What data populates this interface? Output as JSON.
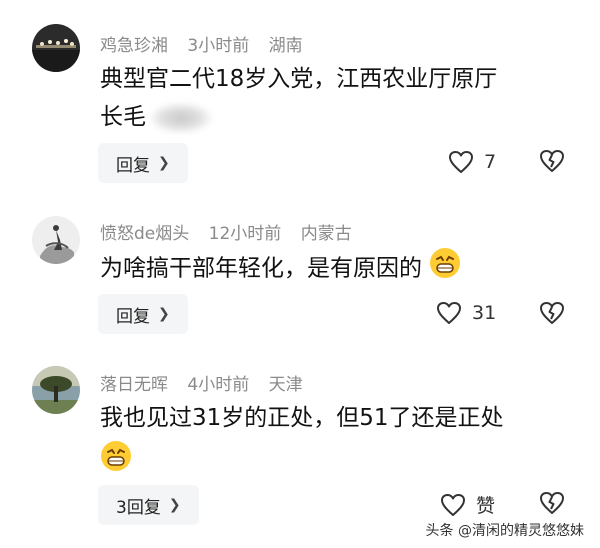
{
  "comments": [
    {
      "username": "鸡急珍湘",
      "time": "3小时前",
      "location": "湖南",
      "text_line1": "典型官二代18岁入党，江西农业厅原厅",
      "text_line2": "长毛",
      "reply_label": "回复",
      "like_count": "7"
    },
    {
      "username": "愤怒de烟头",
      "time": "12小时前",
      "location": "内蒙古",
      "text": "为啥搞干部年轻化，是有原因的",
      "reply_label": "回复",
      "like_count": "31"
    },
    {
      "username": "落日无晖",
      "time": "4小时前",
      "location": "天津",
      "text": "我也见过31岁的正处，但51了还是正处",
      "reply_label": "3回复",
      "like_count": "赞"
    }
  ],
  "watermark": "头条 @清闲的精灵悠悠妹",
  "icons": [
    "heart-icon",
    "broken-heart-icon",
    "chevron-right-icon",
    "grinning-emoji-icon"
  ]
}
